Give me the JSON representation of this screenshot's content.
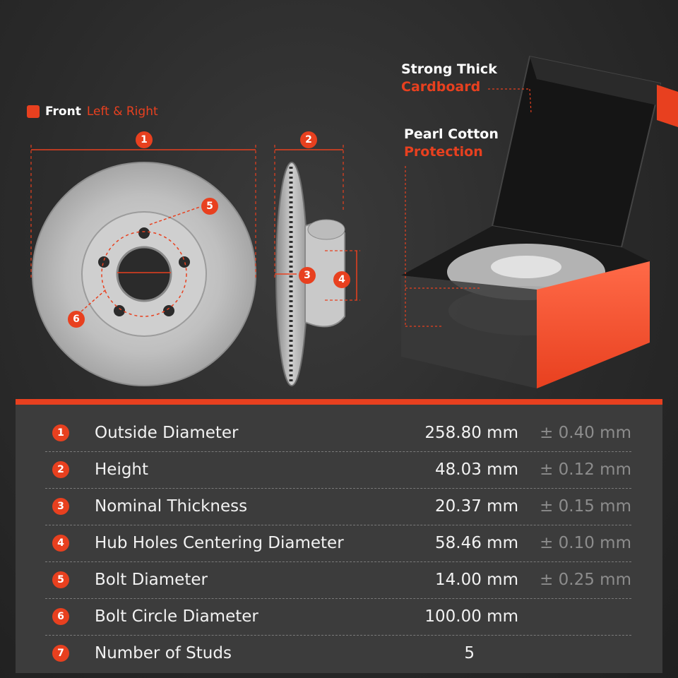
{
  "front": {
    "bold": "Front",
    "sub": "Left & Right"
  },
  "callouts": {
    "cardboard": {
      "line1": "Strong Thick",
      "line2": "Cardboard"
    },
    "cotton": {
      "line1": "Pearl Cotton",
      "line2": "Protection"
    }
  },
  "markers": [
    "1",
    "2",
    "3",
    "4",
    "5",
    "6"
  ],
  "colors": {
    "accent": "#e8401f",
    "background": "#2a2a2a",
    "table_bg": "#3c3c3c"
  },
  "specs": [
    {
      "num": "1",
      "name": "Outside Diameter",
      "value": "258.80 mm",
      "tolerance": "± 0.40 mm"
    },
    {
      "num": "2",
      "name": "Height",
      "value": "48.03 mm",
      "tolerance": "± 0.12 mm"
    },
    {
      "num": "3",
      "name": "Nominal Thickness",
      "value": "20.37 mm",
      "tolerance": "± 0.15 mm"
    },
    {
      "num": "4",
      "name": "Hub Holes Centering Diameter",
      "value": "58.46 mm",
      "tolerance": "± 0.10 mm"
    },
    {
      "num": "5",
      "name": "Bolt Diameter",
      "value": "14.00 mm",
      "tolerance": "± 0.25 mm"
    },
    {
      "num": "6",
      "name": "Bolt Circle Diameter",
      "value": "100.00 mm",
      "tolerance": ""
    },
    {
      "num": "7",
      "name": "Number of Studs",
      "value": "5",
      "tolerance": ""
    }
  ]
}
